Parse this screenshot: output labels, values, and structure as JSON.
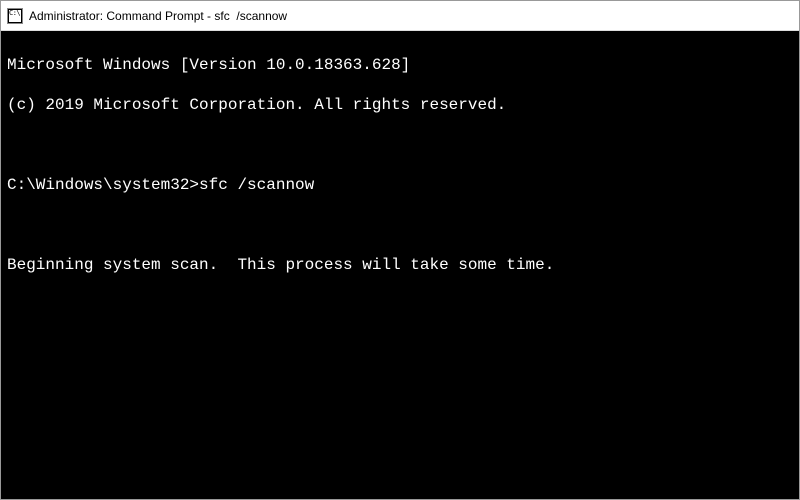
{
  "titlebar": {
    "icon_label": "C:\\",
    "title": "Administrator: Command Prompt - sfc  /scannow"
  },
  "terminal": {
    "line1": "Microsoft Windows [Version 10.0.18363.628]",
    "line2": "(c) 2019 Microsoft Corporation. All rights reserved.",
    "blank1": "",
    "prompt": "C:\\Windows\\system32>",
    "command": "sfc /scannow",
    "blank2": "",
    "status": "Beginning system scan.  This process will take some time."
  }
}
